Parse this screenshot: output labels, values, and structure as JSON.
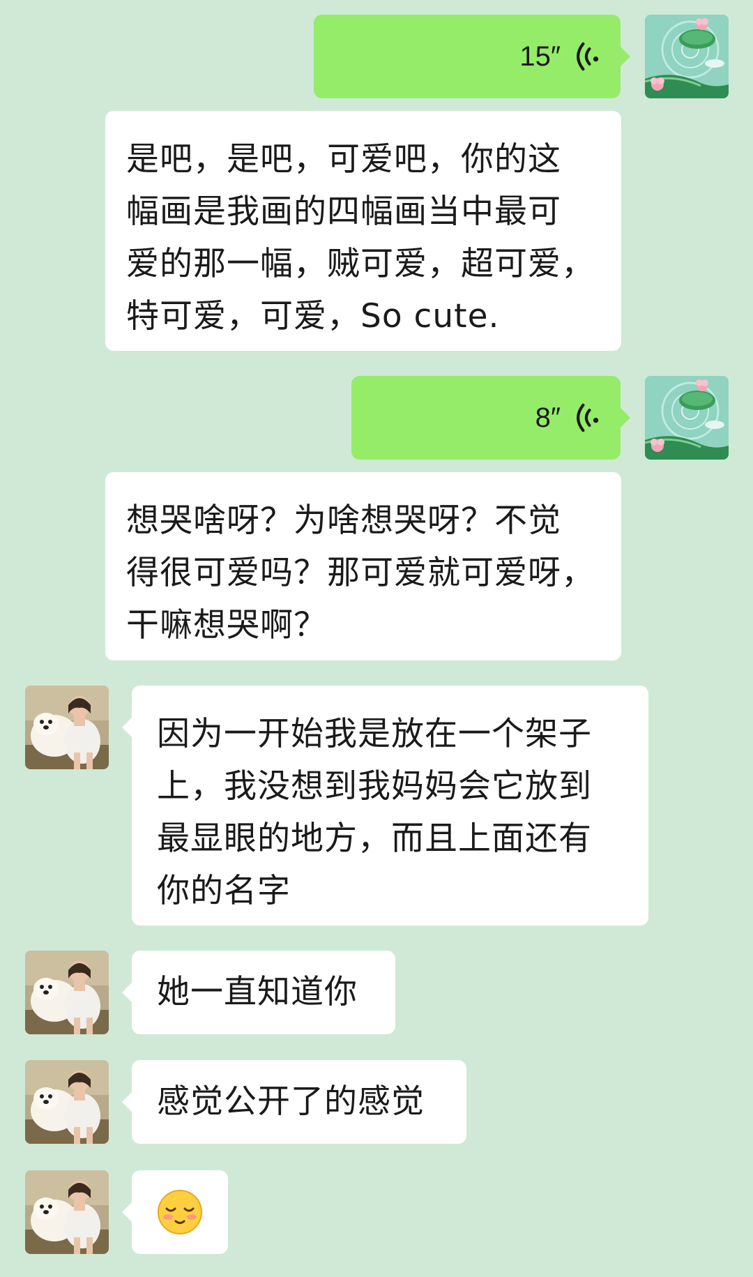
{
  "chat": {
    "messages": [
      {
        "id": "m1",
        "side": "right",
        "kind": "voice",
        "duration": "15″"
      },
      {
        "id": "m2",
        "side": "right-white",
        "kind": "text",
        "text": "是吧，是吧，可爱吧，你的这\n幅画是我画的四幅画当中最可\n爱的那一幅，贼可爱，超可爱，\n特可爱，可爱，So cute."
      },
      {
        "id": "m3",
        "side": "right",
        "kind": "voice",
        "duration": "8″"
      },
      {
        "id": "m4",
        "side": "right-white",
        "kind": "text",
        "text": "想哭啥呀？为啥想哭呀？不觉\n得很可爱吗？那可爱就可爱呀，\n干嘛想哭啊？"
      },
      {
        "id": "m5",
        "side": "left",
        "kind": "text",
        "text": "因为一开始我是放在一个架子\n上，我没想到我妈妈会它放到\n最显眼的地方，而且上面还有\n你的名字"
      },
      {
        "id": "m6",
        "side": "left",
        "kind": "text",
        "text": "她一直知道你"
      },
      {
        "id": "m7",
        "side": "left",
        "kind": "text",
        "text": "感觉公开了的感觉"
      },
      {
        "id": "m8",
        "side": "left",
        "kind": "emoji",
        "emoji": "shy-smile-emoji"
      }
    ]
  },
  "colors": {
    "background": "#cfe9d6",
    "sent_bubble": "#95ec69",
    "received_bubble": "#ffffff",
    "voice_icon": "#1a1a1a"
  },
  "icons": {
    "voice": "voice-wave-icon",
    "self_avatar": "lotus-pond-avatar",
    "peer_avatar": "girl-with-dog-avatar"
  }
}
